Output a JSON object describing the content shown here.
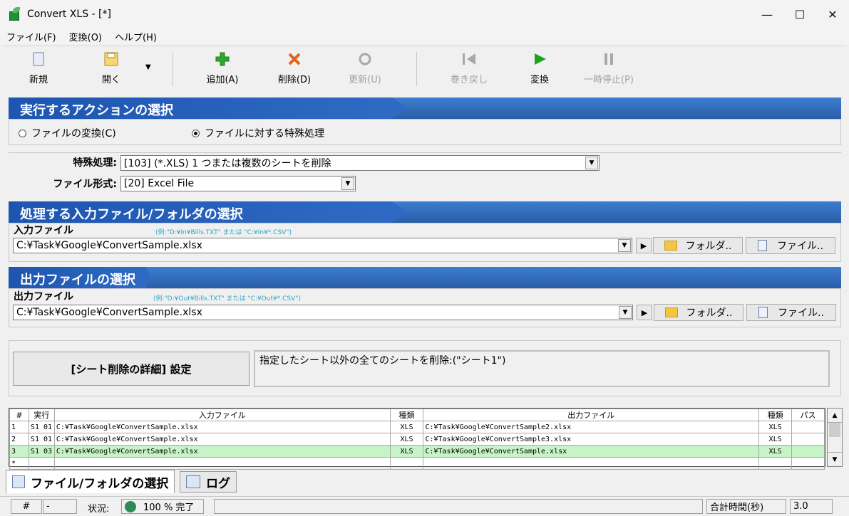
{
  "window": {
    "title": "Convert XLS  - [*]",
    "minimize": "—",
    "maximize": "☐",
    "close": "✕"
  },
  "menu": [
    "ファイル(F)",
    "変換(O)",
    "ヘルプ(H)"
  ],
  "toolbar": {
    "new": "新規",
    "open": "開く",
    "add": "追加(A)",
    "delete": "削除(D)",
    "update": "更新(U)",
    "rewind": "巻き戻し",
    "convert": "変換",
    "pause": "一時停止(P)",
    "colors": {
      "add": "#2fa52f",
      "delete": "#e0651a",
      "convert": "#1fa31f",
      "disabled": "#a8a8a8"
    }
  },
  "action_section": {
    "title": "実行するアクションの選択",
    "option_convert": "ファイルの変換(C)",
    "option_special": "ファイルに対する特殊処理",
    "selected": "special"
  },
  "special": {
    "label_process": "特殊処理:",
    "process_value": "[103] (*.XLS) 1 つまたは複数のシートを削除",
    "label_format": "ファイル形式:",
    "format_value": "[20] Excel File"
  },
  "input_section": {
    "title": "処理する入力ファイル/フォルダの選択",
    "label": "入力ファイル",
    "hint": "(例:\"D:¥In¥Bills.TXT\" または \"C:¥In¥*.CSV\")",
    "value": "C:¥Task¥Google¥ConvertSample.xlsx",
    "folder_btn": "フォルダ..",
    "file_btn": "ファイル.."
  },
  "output_section": {
    "title": "出力ファイルの選択",
    "label": "出力ファイル",
    "hint": "(例:\"D:¥Out¥Bills.TXT\" または \"C:¥Out¥*.CSV\")",
    "value": "C:¥Task¥Google¥ConvertSample.xlsx",
    "folder_btn": "フォルダ..",
    "file_btn": "ファイル.."
  },
  "detail": {
    "button": "[シート削除の詳細] 設定",
    "text": "指定したシート以外の全てのシートを削除:(\"シート1\")"
  },
  "grid": {
    "headers": [
      "#",
      "実行",
      "入力ファイル",
      "種類",
      "出力ファイル",
      "種類",
      "パス"
    ],
    "rows": [
      [
        "1",
        "S1 01",
        "C:¥Task¥Google¥ConvertSample.xlsx",
        "XLS",
        "C:¥Task¥Google¥ConvertSample2.xlsx",
        "XLS",
        ""
      ],
      [
        "2",
        "S1 01",
        "C:¥Task¥Google¥ConvertSample.xlsx",
        "XLS",
        "C:¥Task¥Google¥ConvertSample3.xlsx",
        "XLS",
        ""
      ],
      [
        "3",
        "S1 03",
        "C:¥Task¥Google¥ConvertSample.xlsx",
        "XLS",
        "C:¥Task¥Google¥ConvertSample.xlsx",
        "XLS",
        ""
      ],
      [
        "*",
        "",
        "",
        "",
        "",
        "",
        ""
      ]
    ],
    "selected_row": 2
  },
  "tabs": {
    "files": "ファイル/フォルダの選択",
    "log": "ログ"
  },
  "status": {
    "hash": "#",
    "dash": "-",
    "state_label": "状況:",
    "progress": "100 % 完了",
    "total_label": "合計時間(秒)",
    "total_value": "3.0"
  }
}
